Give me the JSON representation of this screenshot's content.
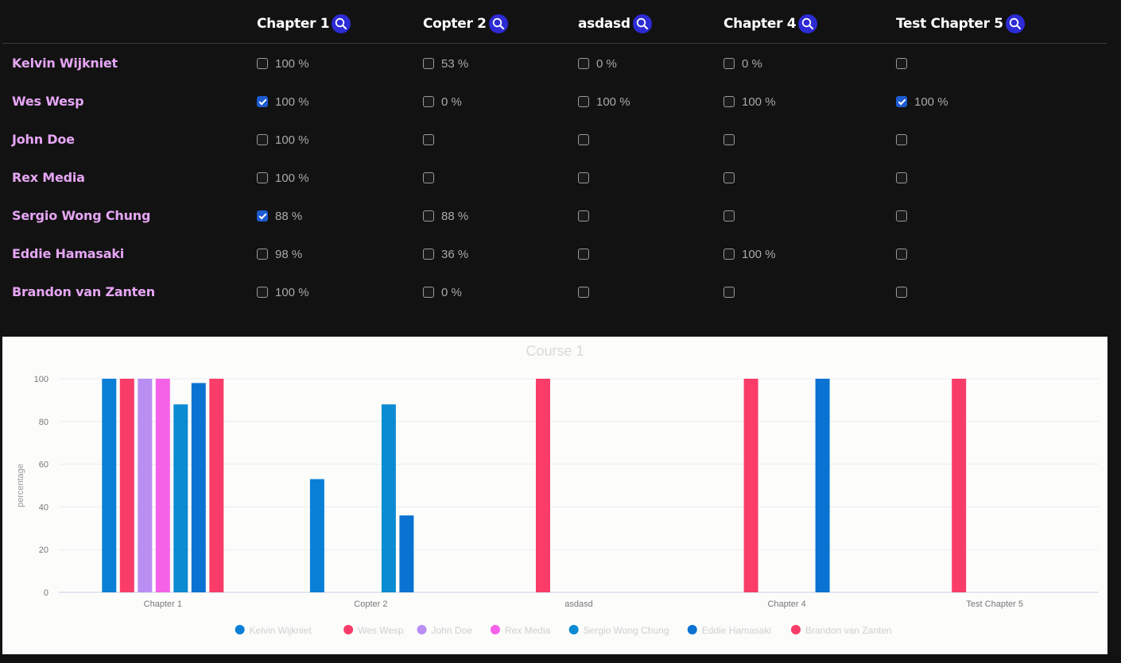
{
  "columns": [
    {
      "label": "Chapter 1",
      "icon": "search-icon"
    },
    {
      "label": "Copter 2",
      "icon": "search-icon"
    },
    {
      "label": "asdasd",
      "icon": "search-icon"
    },
    {
      "label": "Chapter 4",
      "icon": "search-icon"
    },
    {
      "label": "Test Chapter 5",
      "icon": "search-icon"
    }
  ],
  "rows": [
    {
      "name": "Kelvin Wijkniet",
      "cells": [
        {
          "checked": false,
          "pct": "100 %"
        },
        {
          "checked": false,
          "pct": "53 %"
        },
        {
          "checked": false,
          "pct": "0 %"
        },
        {
          "checked": false,
          "pct": "0 %"
        },
        {
          "checked": false,
          "pct": ""
        }
      ]
    },
    {
      "name": "Wes Wesp",
      "cells": [
        {
          "checked": true,
          "pct": "100 %"
        },
        {
          "checked": false,
          "pct": "0 %"
        },
        {
          "checked": false,
          "pct": "100 %"
        },
        {
          "checked": false,
          "pct": "100 %"
        },
        {
          "checked": true,
          "pct": "100 %"
        }
      ]
    },
    {
      "name": "John Doe",
      "cells": [
        {
          "checked": false,
          "pct": "100 %"
        },
        {
          "checked": false,
          "pct": ""
        },
        {
          "checked": false,
          "pct": ""
        },
        {
          "checked": false,
          "pct": ""
        },
        {
          "checked": false,
          "pct": ""
        }
      ]
    },
    {
      "name": "Rex Media",
      "cells": [
        {
          "checked": false,
          "pct": "100 %"
        },
        {
          "checked": false,
          "pct": ""
        },
        {
          "checked": false,
          "pct": ""
        },
        {
          "checked": false,
          "pct": ""
        },
        {
          "checked": false,
          "pct": ""
        }
      ]
    },
    {
      "name": "Sergio Wong Chung",
      "cells": [
        {
          "checked": true,
          "pct": "88 %"
        },
        {
          "checked": false,
          "pct": "88 %"
        },
        {
          "checked": false,
          "pct": ""
        },
        {
          "checked": false,
          "pct": ""
        },
        {
          "checked": false,
          "pct": ""
        }
      ]
    },
    {
      "name": "Eddie Hamasaki",
      "cells": [
        {
          "checked": false,
          "pct": "98 %"
        },
        {
          "checked": false,
          "pct": "36 %"
        },
        {
          "checked": false,
          "pct": ""
        },
        {
          "checked": false,
          "pct": "100 %"
        },
        {
          "checked": false,
          "pct": ""
        }
      ]
    },
    {
      "name": "Brandon van Zanten",
      "cells": [
        {
          "checked": false,
          "pct": "100 %"
        },
        {
          "checked": false,
          "pct": "0 %"
        },
        {
          "checked": false,
          "pct": ""
        },
        {
          "checked": false,
          "pct": ""
        },
        {
          "checked": false,
          "pct": ""
        }
      ]
    }
  ],
  "colors": {
    "background": "#121212",
    "name_text": "#e6a6f5",
    "search_button": "#2d2bd4",
    "checkbox_on": "#1d5bd0"
  },
  "chart_data": {
    "type": "bar",
    "title": "Course 1",
    "xlabel": "",
    "ylabel": "percentage",
    "ylim": [
      0,
      100
    ],
    "yticks": [
      0,
      20,
      40,
      60,
      80,
      100
    ],
    "grid": true,
    "legend_position": "bottom",
    "categories": [
      "Chapter 1",
      "Copter 2",
      "asdasd",
      "Chapter 4",
      "Test Chapter 5"
    ],
    "series": [
      {
        "name": "Kelvin Wijkniet",
        "color": "#0a7fd6",
        "values": [
          100,
          53,
          0,
          0,
          null
        ]
      },
      {
        "name": "Wes Wesp",
        "color": "#f93d68",
        "values": [
          100,
          0,
          100,
          100,
          100
        ]
      },
      {
        "name": "John Doe",
        "color": "#b88ef3",
        "values": [
          100,
          null,
          null,
          null,
          null
        ]
      },
      {
        "name": "Rex Media",
        "color": "#f562e8",
        "values": [
          100,
          null,
          null,
          null,
          null
        ]
      },
      {
        "name": "Sergio Wong Chung",
        "color": "#0a8bd2",
        "values": [
          88,
          88,
          null,
          null,
          null
        ]
      },
      {
        "name": "Eddie Hamasaki",
        "color": "#0a72d2",
        "values": [
          98,
          36,
          null,
          100,
          null
        ]
      },
      {
        "name": "Brandon van Zanten",
        "color": "#f93d68",
        "values": [
          100,
          0,
          null,
          null,
          null
        ]
      }
    ]
  }
}
